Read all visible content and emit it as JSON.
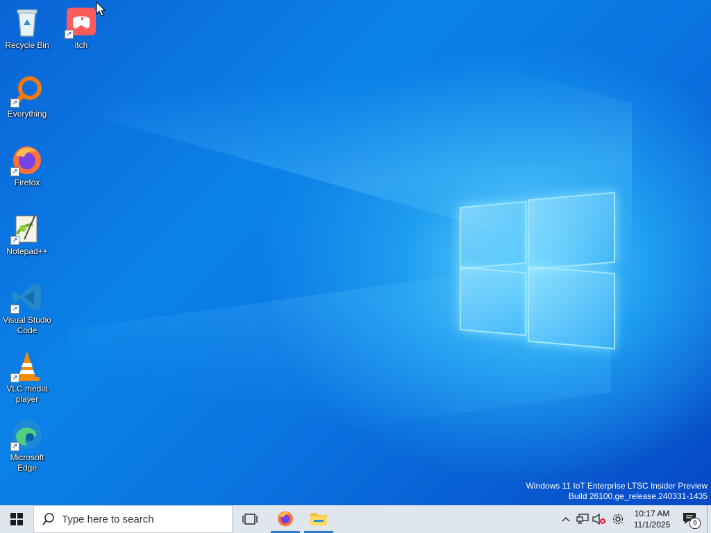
{
  "desktop": {
    "icons": [
      {
        "label": "Recycle Bin",
        "icon": "recycle-bin-icon"
      },
      {
        "label": "itch",
        "icon": "itch-icon"
      },
      {
        "label": "Everything",
        "icon": "everything-icon"
      },
      {
        "label": "Firefox",
        "icon": "firefox-icon"
      },
      {
        "label": "Notepad++",
        "icon": "notepadpp-icon"
      },
      {
        "label": "Visual Studio Code",
        "icon": "vscode-icon"
      },
      {
        "label": "VLC media player",
        "icon": "vlc-icon"
      },
      {
        "label": "Microsoft Edge",
        "icon": "edge-icon"
      }
    ],
    "watermark": {
      "line1": "Windows 11 IoT Enterprise LTSC Insider Preview",
      "line2": "Build 26100.ge_release.240331-1435"
    }
  },
  "taskbar": {
    "search_placeholder": "Type here to search",
    "pinned": [
      "firefox-icon",
      "file-explorer-icon"
    ],
    "clock": {
      "time": "10:17 AM",
      "date": "11/1/2025"
    },
    "notifications_count": "6",
    "tray_icons": [
      "chevron-up-icon",
      "network-icon",
      "volume-muted-icon",
      "settings-gear-icon"
    ]
  }
}
